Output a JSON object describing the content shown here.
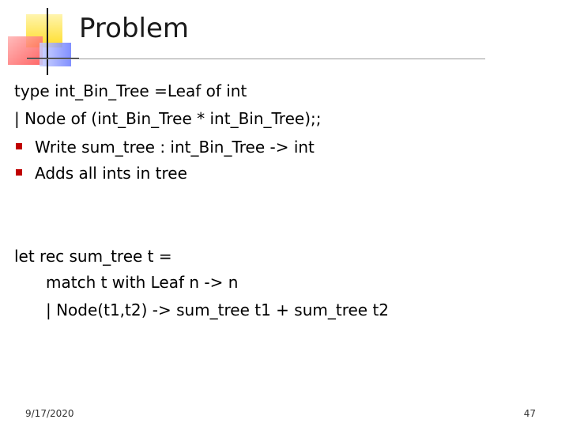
{
  "slide": {
    "title": "Problem",
    "lines": [
      "type int_Bin_Tree =Leaf of int",
      "| Node of (int_Bin_Tree * int_Bin_Tree);;"
    ],
    "bullets": [
      "Write sum_tree : int_Bin_Tree -> int",
      "Adds all ints in tree"
    ],
    "code": [
      "let rec sum_tree t =",
      "match t with Leaf n -> n",
      "| Node(t1,t2) -> sum_tree t1 + sum_tree t2"
    ],
    "colors": {
      "bullet": "#c00000",
      "logo_yellow": "#ffd700",
      "logo_red": "#ff4a4a",
      "logo_blue": "#6a7cff"
    }
  },
  "footer": {
    "date": "9/17/2020",
    "page": "47"
  }
}
